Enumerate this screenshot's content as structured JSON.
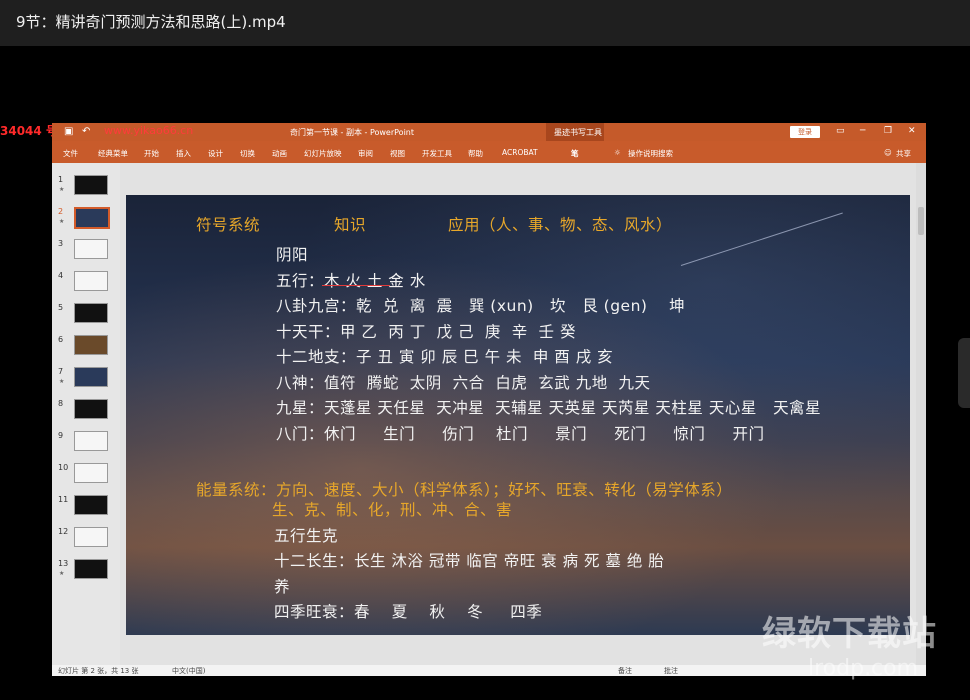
{
  "window": {
    "title": "9节：精讲奇门预测方法和思路(上).mp4"
  },
  "overlay": {
    "red_text": "34044 号",
    "url": "www.yikao66.cn"
  },
  "powerpoint": {
    "doc_title": "奇门第一节课 - 副本  -  PowerPoint",
    "tool_title": "墨迹书写工具",
    "login": "登录",
    "window_buttons": [
      "▭",
      "─",
      "❐",
      "✕"
    ],
    "tabs": [
      "文件",
      "经典菜单",
      "开始",
      "插入",
      "设计",
      "切换",
      "动画",
      "幻灯片放映",
      "审阅",
      "视图",
      "开发工具",
      "帮助",
      "ACROBAT",
      "笔",
      "操作说明搜索"
    ],
    "share": "共享",
    "slide_numbers": [
      "1",
      "2",
      "3",
      "4",
      "5",
      "6",
      "7",
      "8",
      "9",
      "10",
      "11",
      "12",
      "13"
    ],
    "status": {
      "slide": "幻灯片 第 2 张，共 13 张",
      "lang": "中文(中国)",
      "notes": "备注",
      "comments": "批注"
    }
  },
  "slide": {
    "header_symbol": "符号系统",
    "header_knowledge": "知识",
    "header_application": "应用（人、事、物、态、风水）",
    "lines": [
      "阴阳",
      "五行：木 火 土 金 水",
      "八卦九宫：乾  兑  离  震   巽 (xun)   坎   艮 (gen)    坤",
      "十天干：甲 乙  丙 丁  戊 己  庚  辛  壬 癸",
      "十二地支：子 丑 寅 卯 辰 巳 午 未  申 酉 戌 亥",
      "八神：值符  腾蛇  太阴  六合  白虎  玄武 九地  九天",
      "九星：天蓬星 天任星  天冲星  天辅星 天英星 天芮星 天柱星 天心星   天禽星",
      "八门：休门     生门     伤门    杜门     景门     死门     惊门     开门"
    ],
    "energy_line": "能量系统：方向、速度、大小（科学体系）；好坏、旺衰、转化（易学体系）",
    "energy_sub": "生、克、制、化，刑、冲、合、害",
    "lines2": [
      "五行生克",
      "十二长生：长生 沐浴 冠带 临官 帝旺 衰 病 死 墓 绝 胎",
      "养",
      "四季旺衰：春    夏    秋    冬     四季"
    ]
  },
  "watermark": {
    "text": "绿软下载站",
    "url": "lrodp.com"
  }
}
